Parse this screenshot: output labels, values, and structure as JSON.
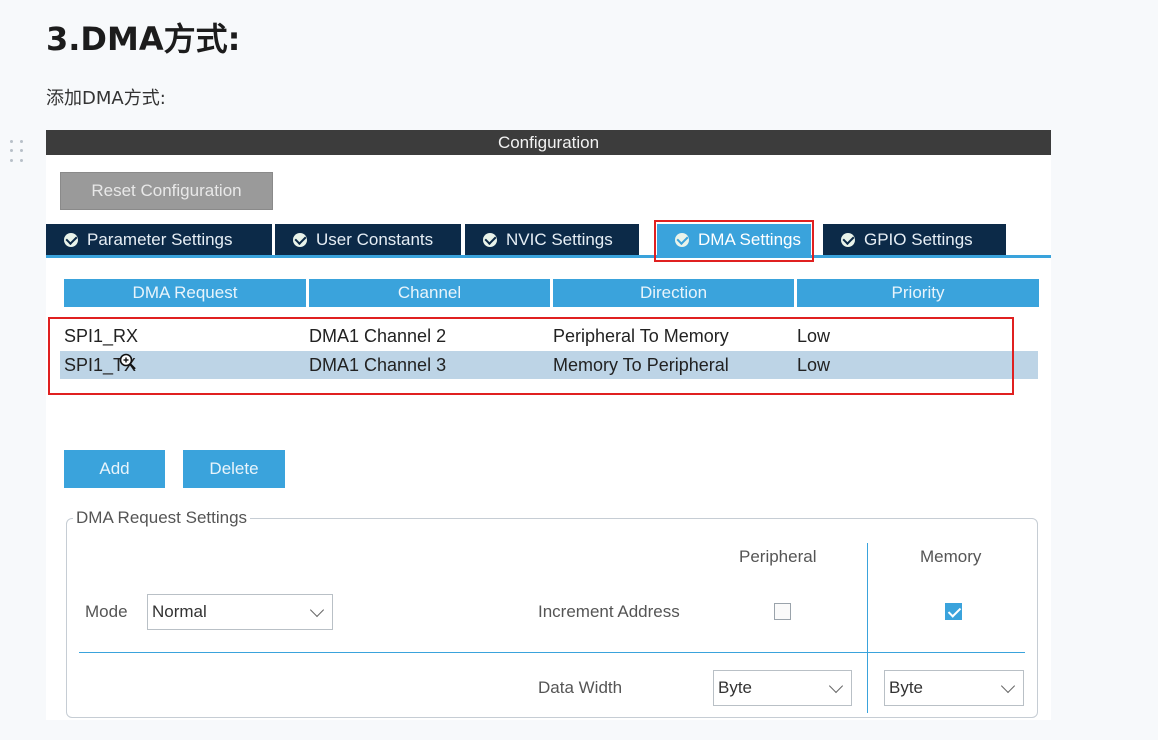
{
  "page": {
    "heading": "3.DMA方式:",
    "subheading": "添加DMA方式:"
  },
  "window": {
    "title": "Configuration",
    "reset_button": "Reset Configuration"
  },
  "tabs": [
    {
      "label": "Parameter Settings",
      "icon": "check-circle-icon"
    },
    {
      "label": "User Constants",
      "icon": "check-circle-icon"
    },
    {
      "label": "NVIC Settings",
      "icon": "check-circle-icon"
    },
    {
      "label": "DMA Settings",
      "icon": "check-circle-icon",
      "active": true
    },
    {
      "label": "GPIO Settings",
      "icon": "check-circle-icon"
    }
  ],
  "table": {
    "columns": [
      "DMA Request",
      "Channel",
      "Direction",
      "Priority"
    ],
    "rows": [
      {
        "request": "SPI1_RX",
        "channel": "DMA1 Channel 2",
        "direction": "Peripheral To Memory",
        "priority": "Low"
      },
      {
        "request": "SPI1_TX",
        "channel": "DMA1 Channel 3",
        "direction": "Memory To Peripheral",
        "priority": "Low",
        "selected": true
      }
    ]
  },
  "actions": {
    "add": "Add",
    "delete": "Delete"
  },
  "request_settings": {
    "legend": "DMA Request Settings",
    "peripheral_header": "Peripheral",
    "memory_header": "Memory",
    "mode_label": "Mode",
    "mode_value": "Normal",
    "increment_label": "Increment Address",
    "peripheral_increment": false,
    "memory_increment": true,
    "data_width_label": "Data Width",
    "peripheral_width": "Byte",
    "memory_width": "Byte"
  },
  "colors": {
    "accent": "#3aa3dc",
    "tab_bg": "#0c2a48",
    "highlight": "#e02020",
    "selected_row": "#bdd4e6"
  }
}
